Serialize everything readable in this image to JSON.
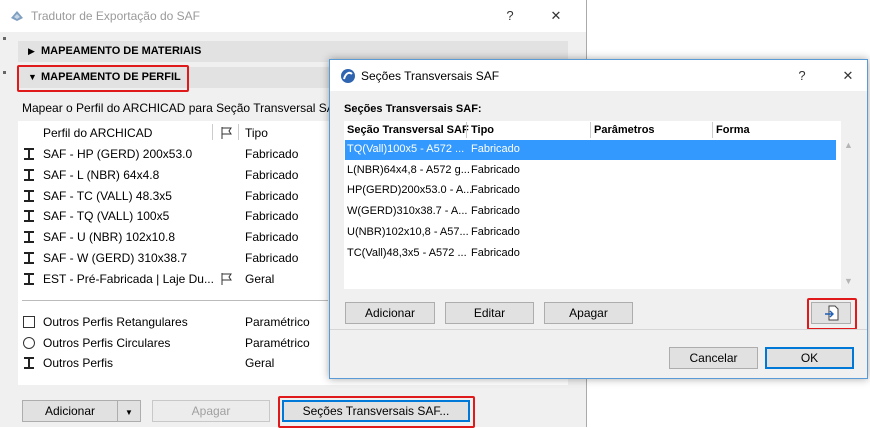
{
  "main_window": {
    "title": "Tradutor de Exportação do SAF",
    "help_label": "?",
    "close_label": "✕",
    "sections": {
      "materials": "MAPEAMENTO DE MATERIAIS",
      "profile": "MAPEAMENTO DE PERFIL"
    },
    "description": "Mapear o Perfil do ARCHICAD para Seção Transversal SAF",
    "columns": {
      "profile": "Perfil do ARCHICAD",
      "type": "Tipo"
    },
    "profiles": [
      {
        "name": "SAF - HP (GERD) 200x53.0",
        "type": "Fabricado",
        "icon": "i-beam-icon"
      },
      {
        "name": "SAF - L (NBR) 64x4.8",
        "type": "Fabricado",
        "icon": "i-beam-icon"
      },
      {
        "name": "SAF - TC (VALL) 48.3x5",
        "type": "Fabricado",
        "icon": "i-beam-icon"
      },
      {
        "name": "SAF - TQ (VALL) 100x5",
        "type": "Fabricado",
        "icon": "i-beam-icon"
      },
      {
        "name": "SAF - U (NBR) 102x10.8",
        "type": "Fabricado",
        "icon": "i-beam-icon"
      },
      {
        "name": "SAF - W (GERD) 310x38.7",
        "type": "Fabricado",
        "icon": "i-beam-icon"
      },
      {
        "name": "EST - Pré-Fabricada | Laje Du...",
        "type": "Geral",
        "icon": "i-beam-icon"
      }
    ],
    "other_profiles": [
      {
        "name": "Outros Perfis Retangulares",
        "type": "Paramétrico",
        "icon": "rectangle-icon"
      },
      {
        "name": "Outros Perfis Circulares",
        "type": "Paramétrico",
        "icon": "circle-icon"
      },
      {
        "name": "Outros Perfis",
        "type": "Geral",
        "icon": "i-beam-icon"
      }
    ],
    "buttons": {
      "add": "Adicionar",
      "delete": "Apagar",
      "saf_sections": "Seções Transversais SAF..."
    }
  },
  "dialog": {
    "title": "Seções Transversais SAF",
    "help_label": "?",
    "close_label": "✕",
    "subtitle": "Seções Transversais SAF:",
    "columns": [
      "Seção Transversal SAF",
      "Tipo",
      "Parâmetros",
      "Forma"
    ],
    "rows": [
      {
        "section": "TQ(Vall)100x5 - A572 ...",
        "type": "Fabricado",
        "selected": true
      },
      {
        "section": "L(NBR)64x4,8 - A572 g...",
        "type": "Fabricado",
        "selected": false
      },
      {
        "section": "HP(GERD)200x53.0 - A...",
        "type": "Fabricado",
        "selected": false
      },
      {
        "section": "W(GERD)310x38.7 - A...",
        "type": "Fabricado",
        "selected": false
      },
      {
        "section": "U(NBR)102x10,8 - A57...",
        "type": "Fabricado",
        "selected": false
      },
      {
        "section": "TC(Vall)48,3x5 - A572 ...",
        "type": "Fabricado",
        "selected": false
      }
    ],
    "buttons": {
      "add": "Adicionar",
      "edit": "Editar",
      "delete": "Apagar",
      "cancel": "Cancelar",
      "ok": "OK"
    }
  },
  "colors": {
    "highlight_red": "#e01a1a",
    "selection_blue": "#3399ff",
    "accent_blue": "#0078d7"
  }
}
